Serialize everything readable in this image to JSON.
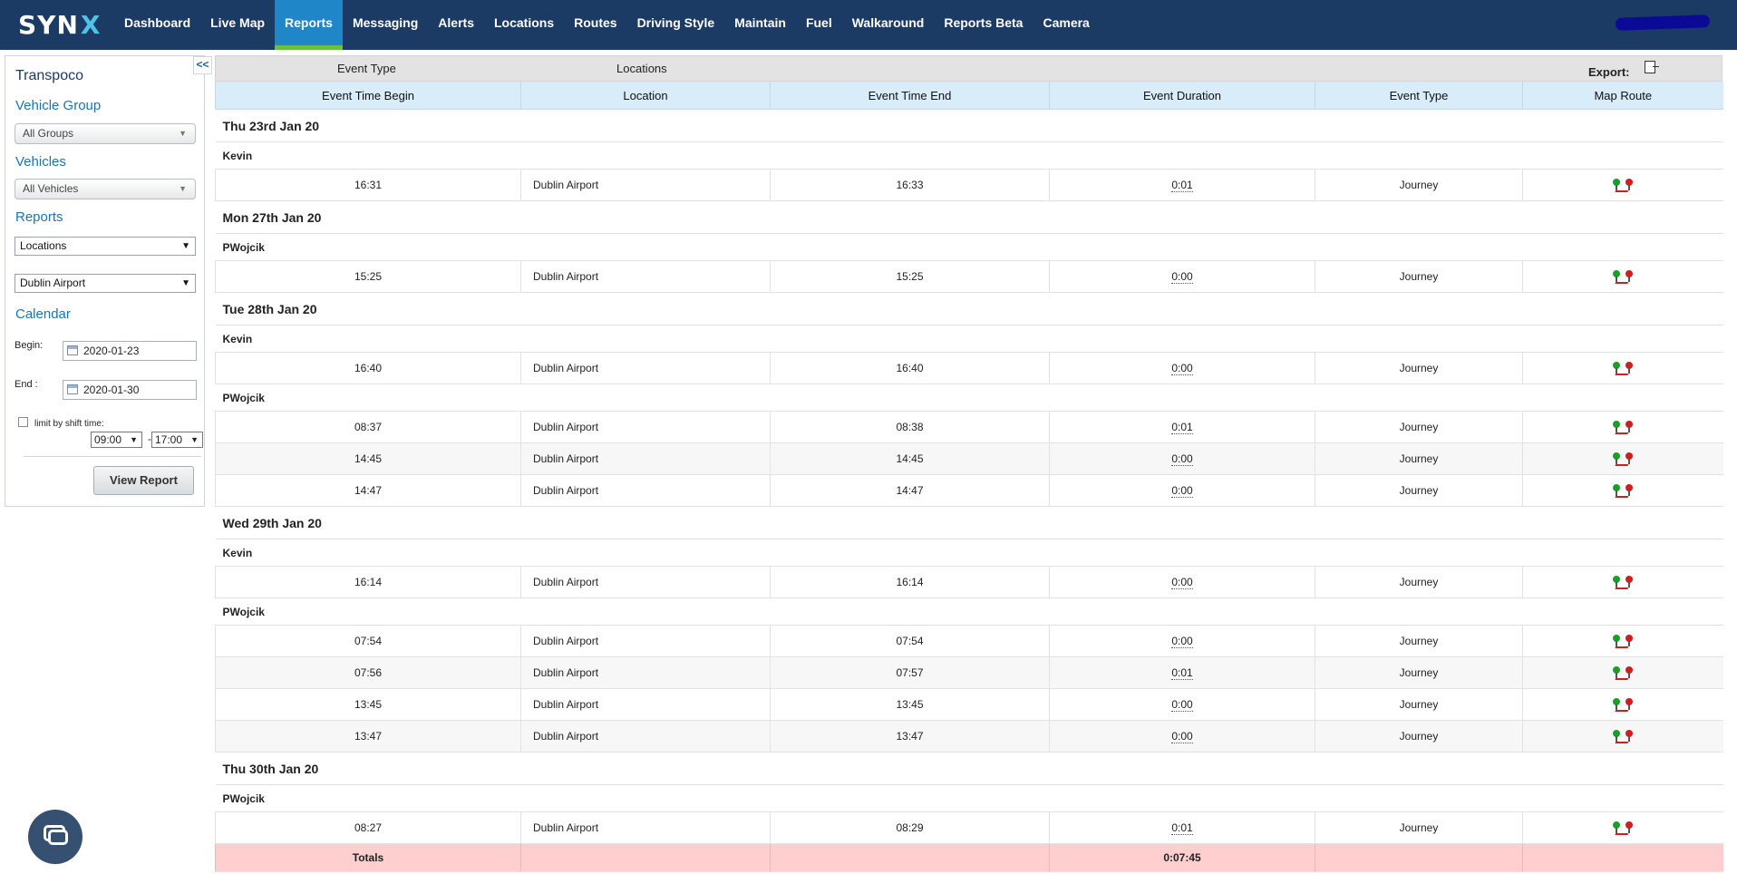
{
  "nav": {
    "brand": "SYN",
    "brand_x": "X",
    "items": [
      "Dashboard",
      "Live Map",
      "Reports",
      "Messaging",
      "Alerts",
      "Locations",
      "Routes",
      "Driving Style",
      "Maintain",
      "Fuel",
      "Walkaround",
      "Reports Beta",
      "Camera"
    ],
    "active": "Reports"
  },
  "sidebar": {
    "company": "Transpoco",
    "vehicle_group_label": "Vehicle Group",
    "vehicle_group_value": "All Groups",
    "vehicles_label": "Vehicles",
    "vehicles_value": "All Vehicles",
    "reports_label": "Reports",
    "report_type": "Locations",
    "location": "Dublin Airport",
    "calendar_label": "Calendar",
    "begin_label": "Begin:",
    "begin_value": "2020-01-23",
    "end_label": "End :",
    "end_value": "2020-01-30",
    "shift_label": "limit by shift time:",
    "shift_start": "09:00",
    "shift_dash": "-",
    "shift_end": "17:00",
    "view_button": "View Report",
    "collapse": "<<"
  },
  "report": {
    "filter_event_type": "Event Type",
    "filter_locations": "Locations",
    "export_label": "Export:",
    "columns": [
      "Event Time Begin",
      "Location",
      "Event Time End",
      "Event Duration",
      "Event Type",
      "Map Route"
    ],
    "groups": [
      {
        "date": "Thu 23rd Jan 20",
        "drivers": [
          {
            "name": "Kevin",
            "rows": [
              [
                "16:31",
                "Dublin Airport",
                "16:33",
                "0:01",
                "Journey"
              ]
            ]
          }
        ]
      },
      {
        "date": "Mon 27th Jan 20",
        "drivers": [
          {
            "name": "PWojcik",
            "rows": [
              [
                "15:25",
                "Dublin Airport",
                "15:25",
                "0:00",
                "Journey"
              ]
            ]
          }
        ]
      },
      {
        "date": "Tue 28th Jan 20",
        "drivers": [
          {
            "name": "Kevin",
            "rows": [
              [
                "16:40",
                "Dublin Airport",
                "16:40",
                "0:00",
                "Journey"
              ]
            ]
          },
          {
            "name": "PWojcik",
            "rows": [
              [
                "08:37",
                "Dublin Airport",
                "08:38",
                "0:01",
                "Journey"
              ],
              [
                "14:45",
                "Dublin Airport",
                "14:45",
                "0:00",
                "Journey"
              ],
              [
                "14:47",
                "Dublin Airport",
                "14:47",
                "0:00",
                "Journey"
              ]
            ]
          }
        ]
      },
      {
        "date": "Wed 29th Jan 20",
        "drivers": [
          {
            "name": "Kevin",
            "rows": [
              [
                "16:14",
                "Dublin Airport",
                "16:14",
                "0:00",
                "Journey"
              ]
            ]
          },
          {
            "name": "PWojcik",
            "rows": [
              [
                "07:54",
                "Dublin Airport",
                "07:54",
                "0:00",
                "Journey"
              ],
              [
                "07:56",
                "Dublin Airport",
                "07:57",
                "0:01",
                "Journey"
              ],
              [
                "13:45",
                "Dublin Airport",
                "13:45",
                "0:00",
                "Journey"
              ],
              [
                "13:47",
                "Dublin Airport",
                "13:47",
                "0:00",
                "Journey"
              ]
            ]
          }
        ]
      },
      {
        "date": "Thu 30th Jan 20",
        "drivers": [
          {
            "name": "PWojcik",
            "rows": [
              [
                "08:27",
                "Dublin Airport",
                "08:29",
                "0:01",
                "Journey"
              ]
            ]
          }
        ]
      }
    ],
    "totals_label": "Totals",
    "totals_duration": "0:07:45"
  },
  "icons": {
    "export": "export-file-icon",
    "map_route": "map-route-pins-icon",
    "chat": "chat-icon",
    "calendar": "calendar-icon"
  }
}
